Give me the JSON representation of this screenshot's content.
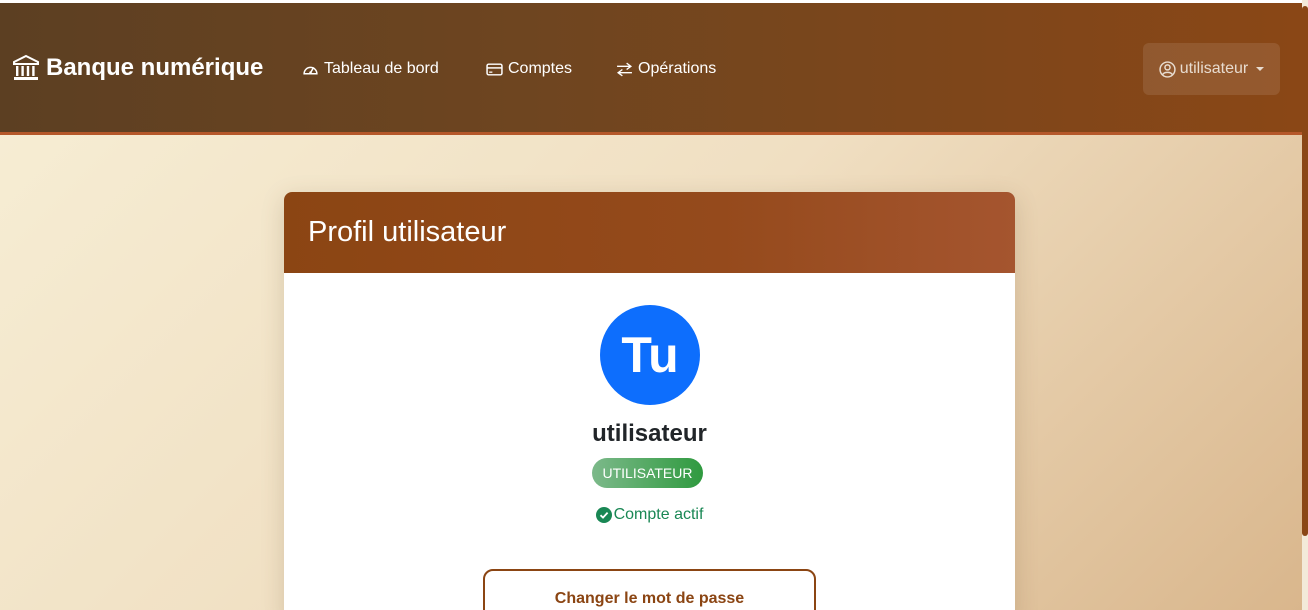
{
  "navbar": {
    "brand": "Banque numérique",
    "brand_icon": "bank-icon",
    "links": [
      {
        "label": "Tableau de bord",
        "icon": "speedometer-icon"
      },
      {
        "label": "Comptes",
        "icon": "credit-card-icon"
      },
      {
        "label": "Opérations",
        "icon": "arrow-left-right-icon"
      }
    ],
    "user_menu": {
      "label": "utilisateur",
      "icon": "person-circle-icon"
    }
  },
  "profile": {
    "title": "Profil utilisateur",
    "avatar_initials": "Tu",
    "username": "utilisateur",
    "role": "UTILISATEUR",
    "status": "Compte actif",
    "change_password_label": "Changer le mot de passe"
  },
  "colors": {
    "brand_brown": "#8b4513",
    "avatar_blue": "#0d6efd",
    "status_green": "#198754"
  }
}
